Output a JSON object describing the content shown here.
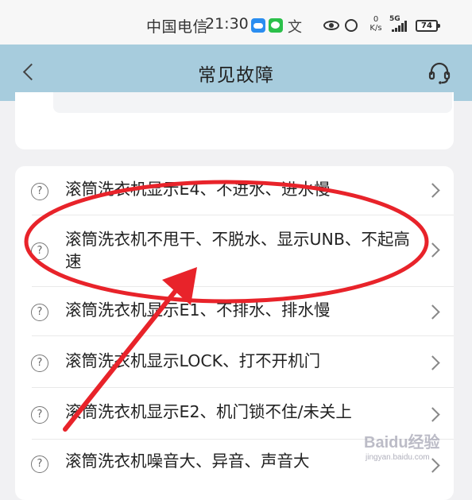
{
  "status_bar": {
    "carrier": "中国电信",
    "time": "21:30",
    "translate_glyph": "文",
    "net_speed_value": "0",
    "net_speed_unit": "K/s",
    "network": "5G",
    "battery": "74"
  },
  "header": {
    "title": "常见故障",
    "back_icon": "chevron-left-icon",
    "support_icon": "headset-icon"
  },
  "faq": {
    "question_icon": "question-circle-icon",
    "question_glyph": "?",
    "items": [
      {
        "text": "滚筒洗衣机显示E4、不进水、进水慢"
      },
      {
        "text": "滚筒洗衣机不甩干、不脱水、显示UNB、不起高速"
      },
      {
        "text": "滚筒洗衣机显示E1、不排水、排水慢"
      },
      {
        "text": "滚筒洗衣机显示LOCK、打不开机门"
      },
      {
        "text": "滚筒洗衣机显示E2、机门锁不住/未关上"
      },
      {
        "text": "滚筒洗衣机噪音大、异音、声音大"
      }
    ]
  },
  "annotations": {
    "highlight_color": "#e8232a",
    "highlighted_item": "滚筒洗衣机不甩干、不脱水、显示UNB、不起高速"
  },
  "watermark": {
    "logo": "Baidu经验",
    "url": "jingyan.baidu.com"
  },
  "colors": {
    "header_bg": "#a7ccdd",
    "page_bg": "#f1f1f3"
  }
}
